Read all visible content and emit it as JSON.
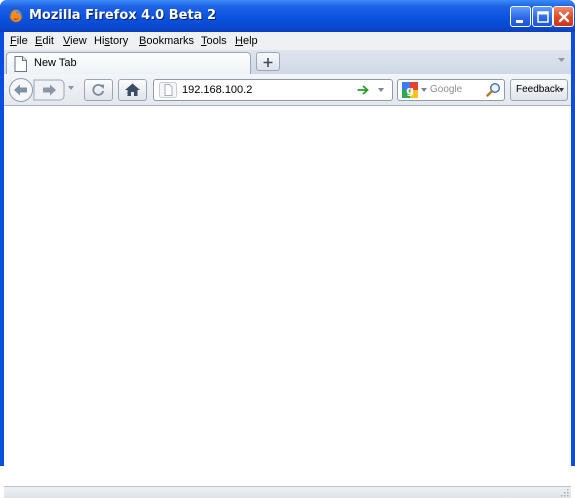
{
  "window": {
    "title": "Mozilla Firefox 4.0 Beta 2",
    "app_icon": "firefox-logo-icon",
    "controls": [
      "minimize-icon",
      "maximize-icon",
      "close-icon"
    ],
    "accent_colors": {
      "titlebar": "#0b52de",
      "close_button": "#de4a26"
    }
  },
  "menubar": {
    "items": [
      {
        "label": "File",
        "mnemonic": "F",
        "rest": "ile"
      },
      {
        "label": "Edit",
        "mnemonic": "E",
        "rest": "dit"
      },
      {
        "label": "View",
        "mnemonic": "V",
        "rest": "iew"
      },
      {
        "label": "History",
        "mnemonic": "",
        "pre": "Hi",
        "mid": "s",
        "post": "tory"
      },
      {
        "label": "Bookmarks",
        "mnemonic": "B",
        "rest": "ookmarks"
      },
      {
        "label": "Tools",
        "mnemonic": "T",
        "rest": "ools"
      },
      {
        "label": "Help",
        "mnemonic": "H",
        "rest": "elp"
      }
    ]
  },
  "tabs": [
    {
      "title": "New Tab",
      "icon": "page-icon",
      "active": true
    }
  ],
  "navbar": {
    "url": "192.168.100.2",
    "search_placeholder": "Google",
    "search_engine_icon": "google-icon",
    "feedback_label": "Feedback"
  },
  "statusbar": {
    "text": ""
  }
}
